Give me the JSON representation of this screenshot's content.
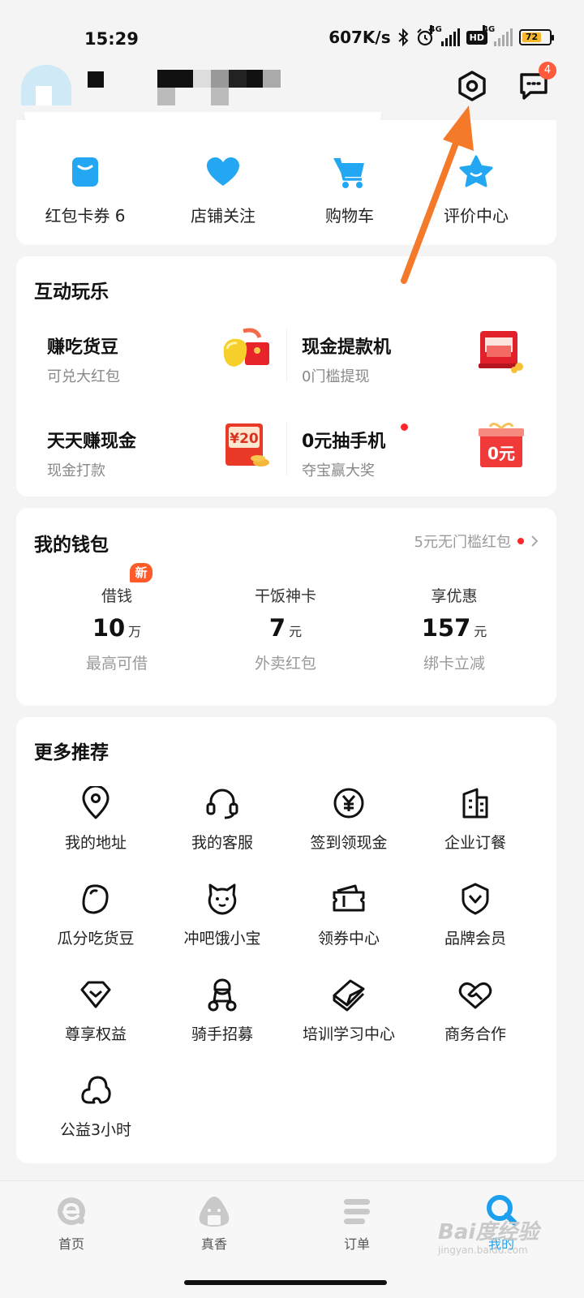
{
  "status_bar": {
    "time": "15:29",
    "network_speed": "607K/s",
    "signal1_type": "4G",
    "hd_label": "HD",
    "signal2_type": "4G",
    "battery": "72",
    "icons": [
      "bluetooth-icon",
      "alarm-icon",
      "signal-icon",
      "battery-icon"
    ]
  },
  "header": {
    "message_badge": "4",
    "settings_icon": "settings-hexagon-icon",
    "message_icon": "message-icon"
  },
  "assets": [
    {
      "label": "红包卡券 6",
      "icon": "coupon-icon",
      "color": "#24a7f3"
    },
    {
      "label": "店铺关注",
      "icon": "heart-icon",
      "color": "#24a7f3"
    },
    {
      "label": "购物车",
      "icon": "cart-icon",
      "color": "#24a7f3"
    },
    {
      "label": "评价中心",
      "icon": "star-icon",
      "color": "#24a7f3"
    }
  ],
  "fun": {
    "title": "互动玩乐",
    "items": [
      {
        "title": "赚吃货豆",
        "subtitle": "可兑大红包",
        "icon": "beans-redpacket-icon"
      },
      {
        "title": "现金提款机",
        "subtitle": "0门槛提现",
        "icon": "atm-icon"
      },
      {
        "title": "天天赚现金",
        "subtitle": "现金打款",
        "icon": "cash-20-icon",
        "pic_text": "¥20"
      },
      {
        "title": "0元抽手机",
        "subtitle": "夺宝赢大奖",
        "icon": "gift-0-icon",
        "pic_text": "0元"
      }
    ]
  },
  "wallet": {
    "title": "我的钱包",
    "link": "5元无门槛红包",
    "new_badge": "新",
    "items": [
      {
        "name": "借钱",
        "value": "10",
        "unit": "万",
        "sub": "最高可借"
      },
      {
        "name": "干饭神卡",
        "value": "7",
        "unit": "元",
        "sub": "外卖红包"
      },
      {
        "name": "享优惠",
        "value": "157",
        "unit": "元",
        "sub": "绑卡立减"
      }
    ]
  },
  "more": {
    "title": "更多推荐",
    "items": [
      {
        "label": "我的地址",
        "icon": "location-icon"
      },
      {
        "label": "我的客服",
        "icon": "headset-icon"
      },
      {
        "label": "签到领现金",
        "icon": "yen-icon"
      },
      {
        "label": "企业订餐",
        "icon": "building-icon"
      },
      {
        "label": "瓜分吃货豆",
        "icon": "bean-icon"
      },
      {
        "label": "冲吧饿小宝",
        "icon": "cat-icon"
      },
      {
        "label": "领券中心",
        "icon": "ticket-icon"
      },
      {
        "label": "品牌会员",
        "icon": "brand-shield-icon"
      },
      {
        "label": "尊享权益",
        "icon": "diamond-icon"
      },
      {
        "label": "骑手招募",
        "icon": "rider-icon"
      },
      {
        "label": "培训学习中心",
        "icon": "book-icon"
      },
      {
        "label": "商务合作",
        "icon": "handshake-icon"
      },
      {
        "label": "公益3小时",
        "icon": "cloud-icon"
      }
    ]
  },
  "bottom_nav": [
    {
      "label": "首页",
      "icon": "home-e-icon"
    },
    {
      "label": "真香",
      "icon": "onigiri-icon"
    },
    {
      "label": "订单",
      "icon": "list-icon"
    },
    {
      "label": "我的",
      "icon": "profile-icon",
      "active": true
    }
  ],
  "watermark": {
    "text": "Bai度经验",
    "sub": "jingyan.baidu.com"
  }
}
